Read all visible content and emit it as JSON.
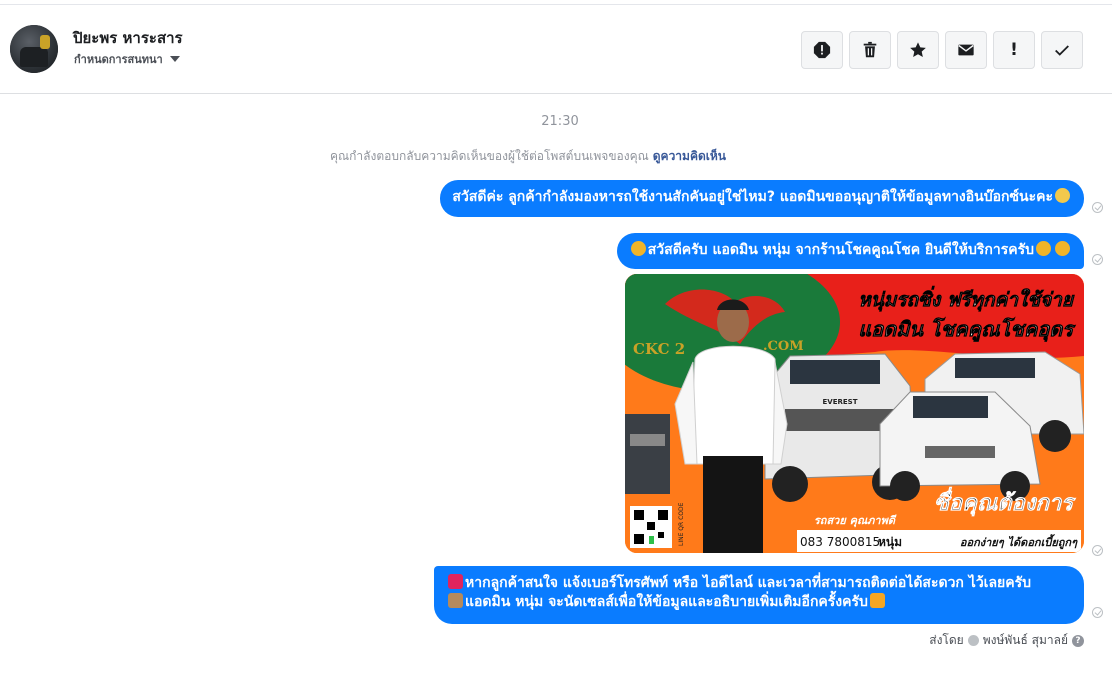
{
  "header": {
    "contact_name": "ปิยะพร หาระสาร",
    "assign_label": "กำหนดการสนทนา",
    "actions": [
      {
        "name": "report-spam",
        "label": "!"
      },
      {
        "name": "delete",
        "label": ""
      },
      {
        "name": "star",
        "label": ""
      },
      {
        "name": "mark-unread",
        "label": ""
      },
      {
        "name": "follow-up",
        "label": "!"
      },
      {
        "name": "mark-done",
        "label": ""
      }
    ]
  },
  "conversation": {
    "timestamp": "21:30",
    "notice_text": "คุณกำลังตอบกลับความคิดเห็นของผู้ใช้ต่อโพสต์บนเพจของคุณ",
    "notice_link": "ดูความคิดเห็น",
    "messages": [
      {
        "text": "สวัสดีค่ะ ลูกค้ากำลังมองหารถใช้งานสักคันอยู่ใช่ไหม? แอดมินขออนุญาติให้ข้อมูลทางอินบ๊อกซ์นะคะ"
      },
      {
        "text": "สวัสดีครับ แอดมิน หนุ่ม จากร้านโชคคูณโชค ยินดีให้บริการครับ"
      },
      {
        "image": {
          "headline_1": "หนุ่มรถซิ่ง ฟรีทุกค่าใช้จ่าย",
          "headline_2": "แอดมิน โชคคูณโชคอุดร",
          "slogan": "ซื่อคุณต้องการ",
          "sub_1": "รถสวย คุณภาพดี",
          "sub_2": "ออกง่ายๆ ได้ดอกเบี้ยถูกๆ",
          "phone": "083 7800815",
          "phone_name": "หนุ่ม",
          "logo_text": "CKC 2",
          "logo_suffix": ".COM",
          "qr_label": "LINE QR CODE",
          "badge": "EVEREST"
        }
      },
      {
        "text_line_1": "หากลูกค้าสนใจ แจ้งเบอร์โทรศัพท์ หรือ ไอดีไลน์ และเวลาที่สามารถติดต่อได้สะดวก ไว้เลยครับ",
        "text_line_2": "แอดมิน หนุ่ม จะนัดเซลส์เพื่อให้ข้อมูลและอธิบายเพิ่มเติมอีกครั้งครับ"
      }
    ],
    "sent_by_label": "ส่งโดย",
    "sent_by_name": "พงษ์พันธ์ สุมาลย์"
  },
  "colors": {
    "bubble": "#0a7cff",
    "ad_red": "#e8201a",
    "ad_orange": "#ff7a1a",
    "ad_green": "#1a7a3a"
  }
}
